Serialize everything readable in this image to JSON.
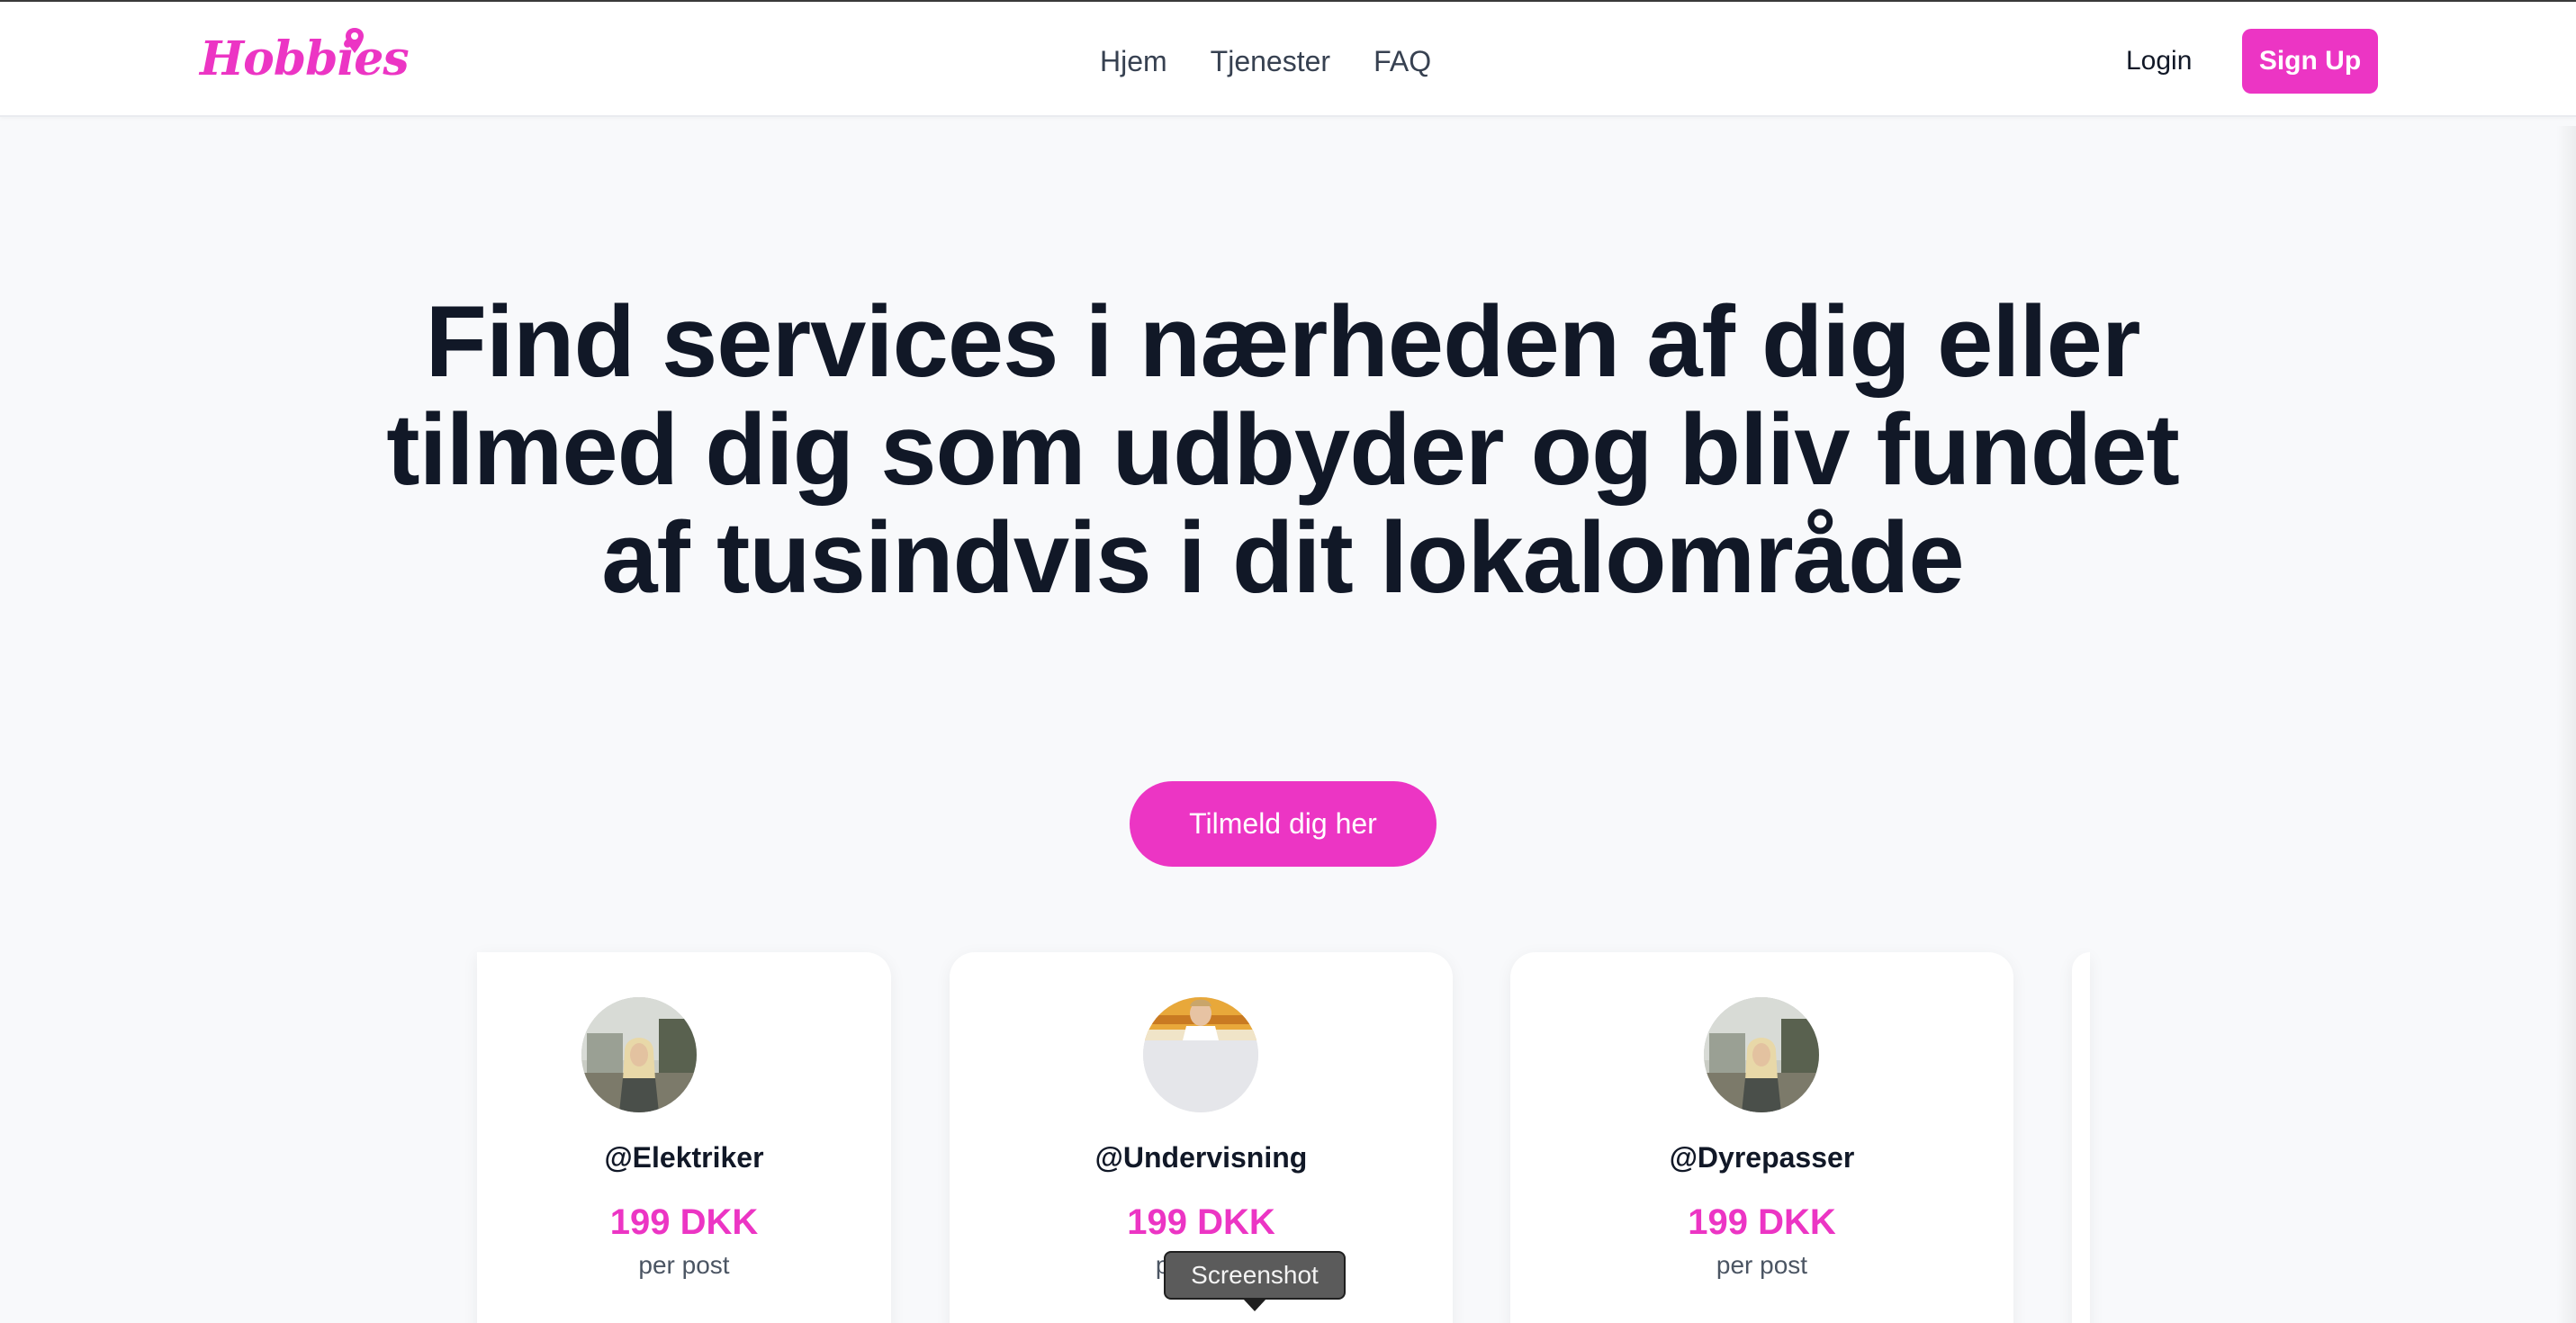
{
  "header": {
    "logo_text": "Hobbies",
    "nav": [
      "Hjem",
      "Tjenester",
      "FAQ"
    ],
    "login_label": "Login",
    "signup_label": "Sign Up"
  },
  "hero": {
    "title": "Find services i nærheden af dig eller tilmed dig som udbyder og bliv fundet af tusindvis i dit lokalområde",
    "cta_label": "Tilmeld dig her"
  },
  "cards": [
    {
      "name": "@Elektriker",
      "price": "199 DKK",
      "unit": "per post"
    },
    {
      "name": "@Undervisning",
      "price": "199 DKK",
      "unit": "per post"
    },
    {
      "name": "@Dyrepasser",
      "price": "199 DKK",
      "unit": "per post"
    }
  ],
  "tooltip": "Screenshot",
  "colors": {
    "brand": "#ec35c4",
    "text": "#111827",
    "background": "#f8f9fb"
  }
}
